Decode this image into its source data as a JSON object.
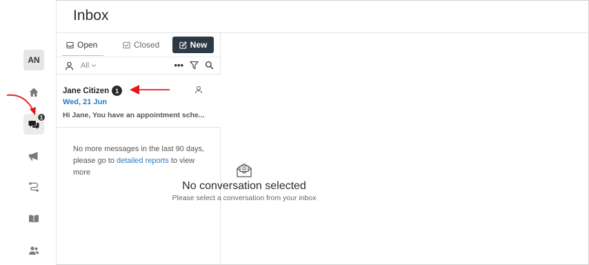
{
  "header": {
    "title": "Inbox"
  },
  "rail": {
    "avatar_initials": "AN",
    "conversations_badge": "1",
    "items": [
      {
        "icon": "home-icon"
      },
      {
        "icon": "conversations-icon",
        "active": true
      },
      {
        "icon": "megaphone-icon"
      },
      {
        "icon": "workflow-icon"
      },
      {
        "icon": "book-icon"
      },
      {
        "icon": "contacts-icon"
      }
    ]
  },
  "tabs": {
    "open_label": "Open",
    "closed_label": "Closed",
    "new_label": "New"
  },
  "filter": {
    "assignee_label": "All",
    "more_label": "•••"
  },
  "conversation": {
    "name": "Jane Citizen",
    "badge": "1",
    "date": "Wed, 21 Jun",
    "preview": "Hi Jane, You have an appointment sche..."
  },
  "empty_note": {
    "text_before": "No more messages in the last 90 days, please go to",
    "link": "detailed reports",
    "text_after": "to view more"
  },
  "detail": {
    "title": "No conversation selected",
    "subtitle": "Please select a conversation from your inbox"
  },
  "colors": {
    "accent": "#2d3a45",
    "link": "#2b7bc4",
    "annotation": "#e8141c"
  }
}
